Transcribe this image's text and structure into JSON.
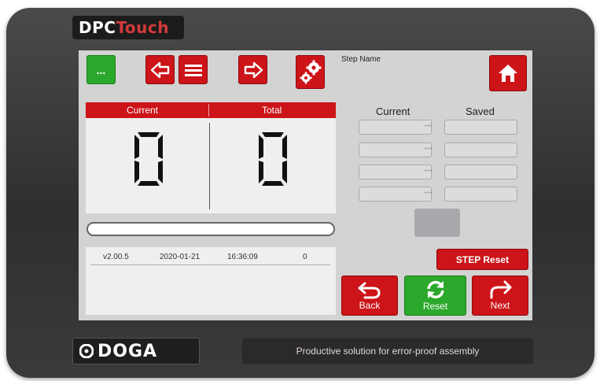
{
  "device": {
    "brand_top": {
      "part1": "DPC",
      "part2": "Touch"
    },
    "brand_bottom": "DOGA",
    "tagline": "Productive solution for error-proof assembly"
  },
  "toolbar": {
    "menu_button_label": "...",
    "step_name_label": "Step Name",
    "icons": [
      "arrow-left-icon",
      "list-icon",
      "arrow-right-icon",
      "gears-icon",
      "home-icon"
    ]
  },
  "counters": {
    "current_label": "Current",
    "total_label": "Total",
    "current_value": "0",
    "total_value": "0"
  },
  "progress": {
    "fraction": 0
  },
  "info": {
    "version": "v2.00.5",
    "date": "2020-01-21",
    "time": "16:36:09",
    "count": "0"
  },
  "params": {
    "current_label": "Current",
    "saved_label": "Saved",
    "rows": 4
  },
  "actions": {
    "step_reset": "STEP Reset",
    "back": "Back",
    "reset": "Reset",
    "next": "Next"
  },
  "colors": {
    "red": "#cc1419",
    "green": "#2ca82c",
    "screen_bg": "#d3d3d3"
  }
}
